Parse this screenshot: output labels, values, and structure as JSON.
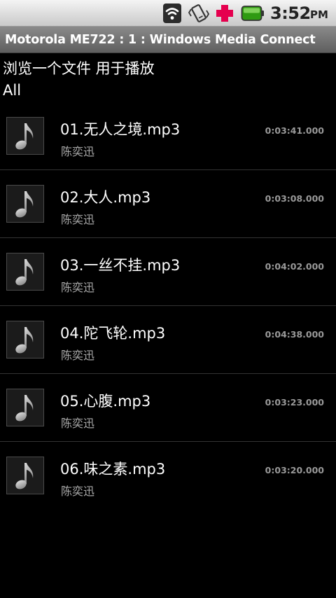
{
  "status_bar": {
    "icons": [
      "wifi-icon",
      "vibrate-icon",
      "health-icon",
      "battery-icon"
    ],
    "time": "3:52",
    "ampm": "PM"
  },
  "title_bar": {
    "title": "Motorola ME722 : 1 : Windows Media Connect"
  },
  "header": {
    "browse_title": "浏览一个文件 用于播放",
    "folder_name": "All"
  },
  "files": [
    {
      "title": "01.无人之境.mp3",
      "artist": "陈奕迅",
      "duration": "0:03:41.000",
      "icon": "music-note-icon"
    },
    {
      "title": "02.大人.mp3",
      "artist": "陈奕迅",
      "duration": "0:03:08.000",
      "icon": "music-note-icon"
    },
    {
      "title": "03.一丝不挂.mp3",
      "artist": "陈奕迅",
      "duration": "0:04:02.000",
      "icon": "music-note-icon"
    },
    {
      "title": "04.陀飞轮.mp3",
      "artist": "陈奕迅",
      "duration": "0:04:38.000",
      "icon": "music-note-icon"
    },
    {
      "title": "05.心腹.mp3",
      "artist": "陈奕迅",
      "duration": "0:03:23.000",
      "icon": "music-note-icon"
    },
    {
      "title": "06.味之素.mp3",
      "artist": "陈奕迅",
      "duration": "0:03:20.000",
      "icon": "music-note-icon"
    }
  ],
  "colors": {
    "background": "#000000",
    "title_bar": "#6f6f6f",
    "health_cross": "#e5004e",
    "battery_green": "#3faa1e",
    "secondary_text": "#a8a8a8"
  }
}
